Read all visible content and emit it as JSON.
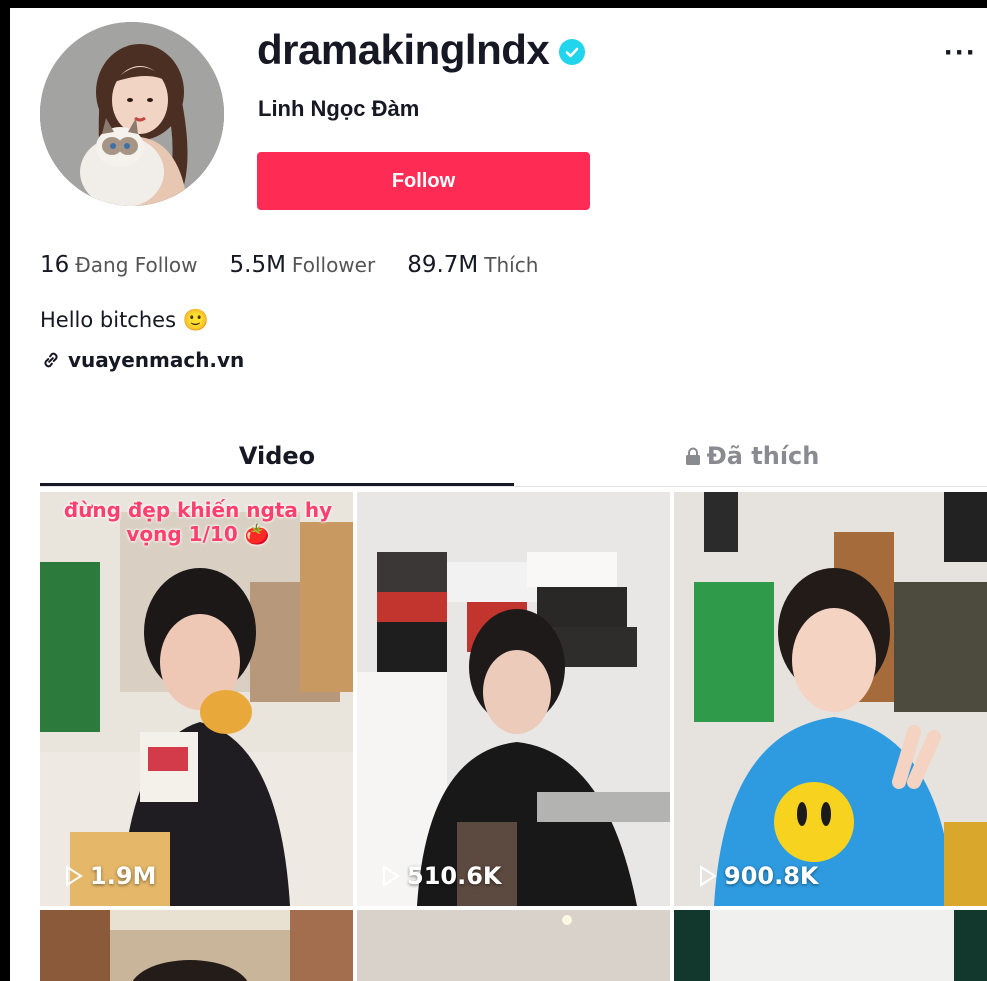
{
  "profile": {
    "username": "dramakinglndx",
    "nickname": "Linh Ngọc Đàm",
    "follow_label": "Follow",
    "more_label": "···",
    "verified_icon": "verified-badge-icon"
  },
  "stats": [
    {
      "num": "16",
      "label": "Đang Follow"
    },
    {
      "num": "5.5M",
      "label": "Follower"
    },
    {
      "num": "89.7M",
      "label": "Thích"
    }
  ],
  "bio": "Hello bitches 🙂",
  "link": {
    "text": "vuayenmach.vn",
    "icon": "link-icon"
  },
  "tabs": {
    "video": "Video",
    "liked": "Đã thích"
  },
  "videos": [
    {
      "views": "1.9M",
      "caption": "đừng đẹp khiến ngta hy vọng 1/10 🍅"
    },
    {
      "views": "510.6K",
      "caption": ""
    },
    {
      "views": "900.8K",
      "caption": ""
    }
  ],
  "colors": {
    "accent": "#fe2c55",
    "verified": "#20d5ec"
  }
}
